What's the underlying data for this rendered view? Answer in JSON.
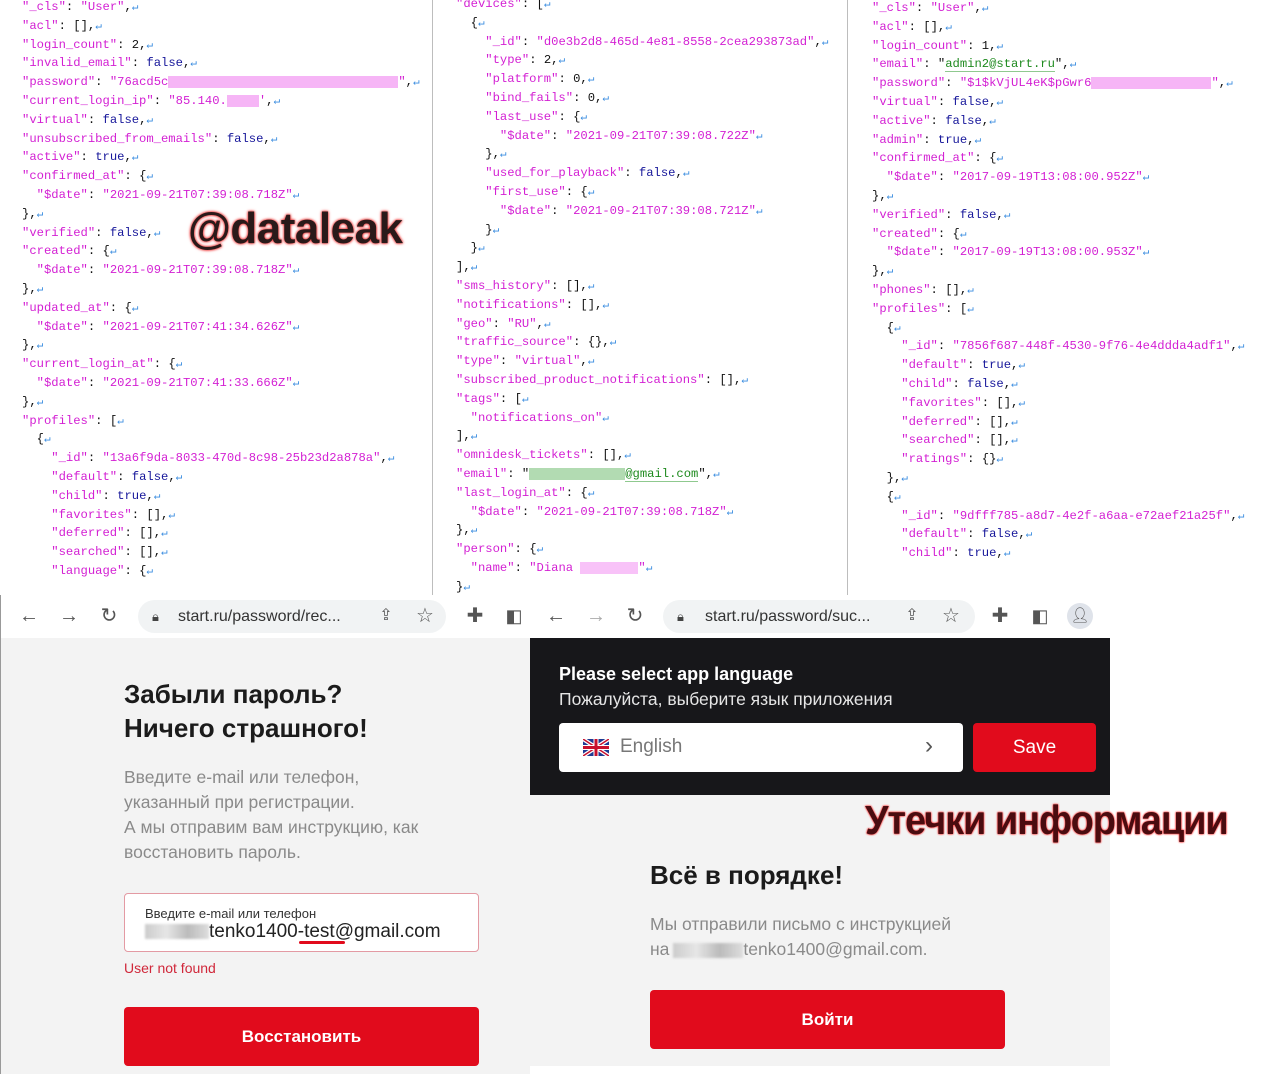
{
  "json_columns": [
    [
      {
        "i": 0,
        "k": "_cls",
        "v": "\"User\"",
        "t": "s",
        "e": ","
      },
      {
        "i": 0,
        "k": "acl",
        "v": "[]",
        "t": "p",
        "e": ","
      },
      {
        "i": 0,
        "k": "login_count",
        "v": "2",
        "t": "n",
        "e": ","
      },
      {
        "i": 0,
        "k": "invalid_email",
        "v": "false",
        "t": "kw",
        "e": ","
      },
      {
        "i": 0,
        "k": "password",
        "v": "\"76acd5c",
        "t": "s",
        "rd": "#f4a3f4",
        "v2": "\"",
        "e": ","
      },
      {
        "i": 0,
        "k": "current_login_ip",
        "v": "\"85.140.",
        "t": "s",
        "rd": "#f4a3f4",
        "v2": "'",
        "e": ","
      },
      {
        "i": 0,
        "k": "virtual",
        "v": "false",
        "t": "kw",
        "e": ","
      },
      {
        "i": 0,
        "k": "unsubscribed_from_emails",
        "v": "false",
        "t": "kw",
        "e": ","
      },
      {
        "i": 0,
        "k": "active",
        "v": "true",
        "t": "kw",
        "e": ","
      },
      {
        "i": 0,
        "k": "confirmed_at",
        "v": "{",
        "t": "p",
        "e": ""
      },
      {
        "i": 1,
        "k": "$date",
        "v": "\"2021-09-21T07:39:08.718Z\"",
        "t": "s",
        "e": ""
      },
      {
        "i": 0,
        "p": "},"
      },
      {
        "i": 0,
        "k": "verified",
        "v": "false",
        "t": "kw",
        "e": ","
      },
      {
        "i": 0,
        "k": "created",
        "v": "{",
        "t": "p",
        "e": ""
      },
      {
        "i": 1,
        "k": "$date",
        "v": "\"2021-09-21T07:39:08.718Z\"",
        "t": "s",
        "e": ""
      },
      {
        "i": 0,
        "p": "},"
      },
      {
        "i": 0,
        "k": "updated_at",
        "v": "{",
        "t": "p",
        "e": ""
      },
      {
        "i": 1,
        "k": "$date",
        "v": "\"2021-09-21T07:41:34.626Z\"",
        "t": "s",
        "e": ""
      },
      {
        "i": 0,
        "p": "},"
      },
      {
        "i": 0,
        "k": "current_login_at",
        "v": "{",
        "t": "p",
        "e": ""
      },
      {
        "i": 1,
        "k": "$date",
        "v": "\"2021-09-21T07:41:33.666Z\"",
        "t": "s",
        "e": ""
      },
      {
        "i": 0,
        "p": "},"
      },
      {
        "i": 0,
        "k": "profiles",
        "v": "[",
        "t": "p",
        "e": ""
      },
      {
        "i": 1,
        "p": "{"
      },
      {
        "i": 2,
        "k": "_id",
        "v": "\"13a6f9da-8033-470d-8c98-25b23d2a878a\"",
        "t": "s",
        "e": ","
      },
      {
        "i": 2,
        "k": "default",
        "v": "false",
        "t": "kw",
        "e": ","
      },
      {
        "i": 2,
        "k": "child",
        "v": "true",
        "t": "kw",
        "e": ","
      },
      {
        "i": 2,
        "k": "favorites",
        "v": "[]",
        "t": "p",
        "e": ","
      },
      {
        "i": 2,
        "k": "deferred",
        "v": "[]",
        "t": "p",
        "e": ","
      },
      {
        "i": 2,
        "k": "searched",
        "v": "[]",
        "t": "p",
        "e": ","
      },
      {
        "i": 2,
        "k": "language",
        "v": "{",
        "t": "p",
        "e": ""
      }
    ],
    [
      {
        "i": 0,
        "k": "devices",
        "v": "[",
        "t": "p",
        "e": ""
      },
      {
        "i": 1,
        "p": "{"
      },
      {
        "i": 2,
        "k": "_id",
        "v": "\"d0e3b2d8-465d-4e81-8558-2cea293873ad\"",
        "t": "s",
        "e": ","
      },
      {
        "i": 2,
        "k": "type",
        "v": "2",
        "t": "n",
        "e": ","
      },
      {
        "i": 2,
        "k": "platform",
        "v": "0",
        "t": "n",
        "e": ","
      },
      {
        "i": 2,
        "k": "bind_fails",
        "v": "0",
        "t": "n",
        "e": ","
      },
      {
        "i": 2,
        "k": "last_use",
        "v": "{",
        "t": "p",
        "e": ""
      },
      {
        "i": 3,
        "k": "$date",
        "v": "\"2021-09-21T07:39:08.722Z\"",
        "t": "s",
        "e": ""
      },
      {
        "i": 2,
        "p": "},"
      },
      {
        "i": 2,
        "k": "used_for_playback",
        "v": "false",
        "t": "kw",
        "e": ","
      },
      {
        "i": 2,
        "k": "first_use",
        "v": "{",
        "t": "p",
        "e": ""
      },
      {
        "i": 3,
        "k": "$date",
        "v": "\"2021-09-21T07:39:08.721Z\"",
        "t": "s",
        "e": ""
      },
      {
        "i": 2,
        "p": "}"
      },
      {
        "i": 1,
        "p": "}"
      },
      {
        "i": 0,
        "p": "],"
      },
      {
        "i": 0,
        "k": "sms_history",
        "v": "[]",
        "t": "p",
        "e": ","
      },
      {
        "i": 0,
        "k": "notifications",
        "v": "[]",
        "t": "p",
        "e": ","
      },
      {
        "i": 0,
        "k": "geo",
        "v": "\"RU\"",
        "t": "s",
        "e": ","
      },
      {
        "i": 0,
        "k": "traffic_source",
        "v": "{}",
        "t": "p",
        "e": ","
      },
      {
        "i": 0,
        "k": "type",
        "v": "\"virtual\"",
        "t": "s",
        "e": ","
      },
      {
        "i": 0,
        "k": "subscribed_product_notifications",
        "v": "[]",
        "t": "p",
        "e": ","
      },
      {
        "i": 0,
        "k": "tags",
        "v": "[",
        "t": "p",
        "e": ""
      },
      {
        "i": 1,
        "s": "\"notifications_on\""
      },
      {
        "i": 0,
        "p": "],"
      },
      {
        "i": 0,
        "k": "omnidesk_tickets",
        "v": "[]",
        "t": "p",
        "e": ","
      },
      {
        "i": 0,
        "k": "email",
        "v": "\"",
        "t": "p",
        "rd": "#9fd29f",
        "v2": "@gmail.com",
        "t2": "em",
        "v3": "\"",
        "e": ","
      },
      {
        "i": 0,
        "k": "last_login_at",
        "v": "{",
        "t": "p",
        "e": ""
      },
      {
        "i": 1,
        "k": "$date",
        "v": "\"2021-09-21T07:39:08.718Z\"",
        "t": "s",
        "e": ""
      },
      {
        "i": 0,
        "p": "},"
      },
      {
        "i": 0,
        "k": "person",
        "v": "{",
        "t": "p",
        "e": ""
      },
      {
        "i": 1,
        "k": "name",
        "v": "\"Diana ",
        "t": "s",
        "rd": "#f6b3f6",
        "v2": "\"",
        "e": ""
      },
      {
        "i": 0,
        "p": "}"
      }
    ],
    [
      {
        "i": 0,
        "k": "_cls",
        "v": "\"User\"",
        "t": "s",
        "e": ","
      },
      {
        "i": 0,
        "k": "acl",
        "v": "[]",
        "t": "p",
        "e": ","
      },
      {
        "i": 0,
        "k": "login_count",
        "v": "1",
        "t": "n",
        "e": ","
      },
      {
        "i": 0,
        "k": "email",
        "v": "\"",
        "t": "p",
        "v2": "admin2@start.ru",
        "t2": "em",
        "v3": "\"",
        "e": ","
      },
      {
        "i": 0,
        "k": "password",
        "v": "\"$1$kVjUL4eK$pGwr6",
        "t": "s",
        "rd": "#f4a3f4",
        "v2": "\"",
        "e": ","
      },
      {
        "i": 0,
        "k": "virtual",
        "v": "false",
        "t": "kw",
        "e": ","
      },
      {
        "i": 0,
        "k": "active",
        "v": "false",
        "t": "kw",
        "e": ","
      },
      {
        "i": 0,
        "k": "admin",
        "v": "true",
        "t": "kw",
        "e": ","
      },
      {
        "i": 0,
        "k": "confirmed_at",
        "v": "{",
        "t": "p",
        "e": ""
      },
      {
        "i": 1,
        "k": "$date",
        "v": "\"2017-09-19T13:08:00.952Z\"",
        "t": "s",
        "e": ""
      },
      {
        "i": 0,
        "p": "},"
      },
      {
        "i": 0,
        "k": "verified",
        "v": "false",
        "t": "kw",
        "e": ","
      },
      {
        "i": 0,
        "k": "created",
        "v": "{",
        "t": "p",
        "e": ""
      },
      {
        "i": 1,
        "k": "$date",
        "v": "\"2017-09-19T13:08:00.953Z\"",
        "t": "s",
        "e": ""
      },
      {
        "i": 0,
        "p": "},"
      },
      {
        "i": 0,
        "k": "phones",
        "v": "[]",
        "t": "p",
        "e": ","
      },
      {
        "i": 0,
        "k": "profiles",
        "v": "[",
        "t": "p",
        "e": ""
      },
      {
        "i": 1,
        "p": "{"
      },
      {
        "i": 2,
        "k": "_id",
        "v": "\"7856f687-448f-4530-9f76-4e4ddda4adf1\"",
        "t": "s",
        "e": ","
      },
      {
        "i": 2,
        "k": "default",
        "v": "true",
        "t": "kw",
        "e": ","
      },
      {
        "i": 2,
        "k": "child",
        "v": "false",
        "t": "kw",
        "e": ","
      },
      {
        "i": 2,
        "k": "favorites",
        "v": "[]",
        "t": "p",
        "e": ","
      },
      {
        "i": 2,
        "k": "deferred",
        "v": "[]",
        "t": "p",
        "e": ","
      },
      {
        "i": 2,
        "k": "searched",
        "v": "[]",
        "t": "p",
        "e": ","
      },
      {
        "i": 2,
        "k": "ratings",
        "v": "{}",
        "t": "p",
        "e": ""
      },
      {
        "i": 1,
        "p": "},"
      },
      {
        "i": 1,
        "p": "{"
      },
      {
        "i": 2,
        "k": "_id",
        "v": "\"9dfff785-a8d7-4e2f-a6aa-e72aef21a25f\"",
        "t": "s",
        "e": ","
      },
      {
        "i": 2,
        "k": "default",
        "v": "false",
        "t": "kw",
        "e": ","
      },
      {
        "i": 2,
        "k": "child",
        "v": "true",
        "t": "kw",
        "e": ","
      }
    ]
  ],
  "newline_glyph": "↵",
  "watermarks": {
    "top": "@dataleak",
    "bottom": "Утечки информации"
  },
  "browser_left": {
    "url": "start.ru/password/rec...",
    "heading_line1": "Забыли пароль?",
    "heading_line2": "Ничего страшного!",
    "description": [
      "Введите e-mail или телефон,",
      "указанный при регистрации.",
      "А мы отправим вам инструкцию, как",
      "восстановить пароль."
    ],
    "input_label": "Введите e-mail или телефон",
    "input_value_visible": "tenko1400-test@gmail.com",
    "error": "User not found",
    "submit": "Восстановить"
  },
  "browser_right": {
    "url": "start.ru/password/suc...",
    "banner_title": "Please select app language",
    "banner_subtitle": "Пожалуйста, выберите язык приложения",
    "language": "English",
    "save": "Save",
    "heading": "Всё в порядке!",
    "message_line1": "Мы отправили письмо с инструкцией",
    "message_prefix": "на",
    "message_email_visible": "tenko1400@gmail.com.",
    "login": "Войти"
  },
  "colors": {
    "accent_red": "#e10b1c",
    "banner": "#17171a",
    "json_key": "#d31fd3",
    "json_keyword": "#16169a"
  }
}
